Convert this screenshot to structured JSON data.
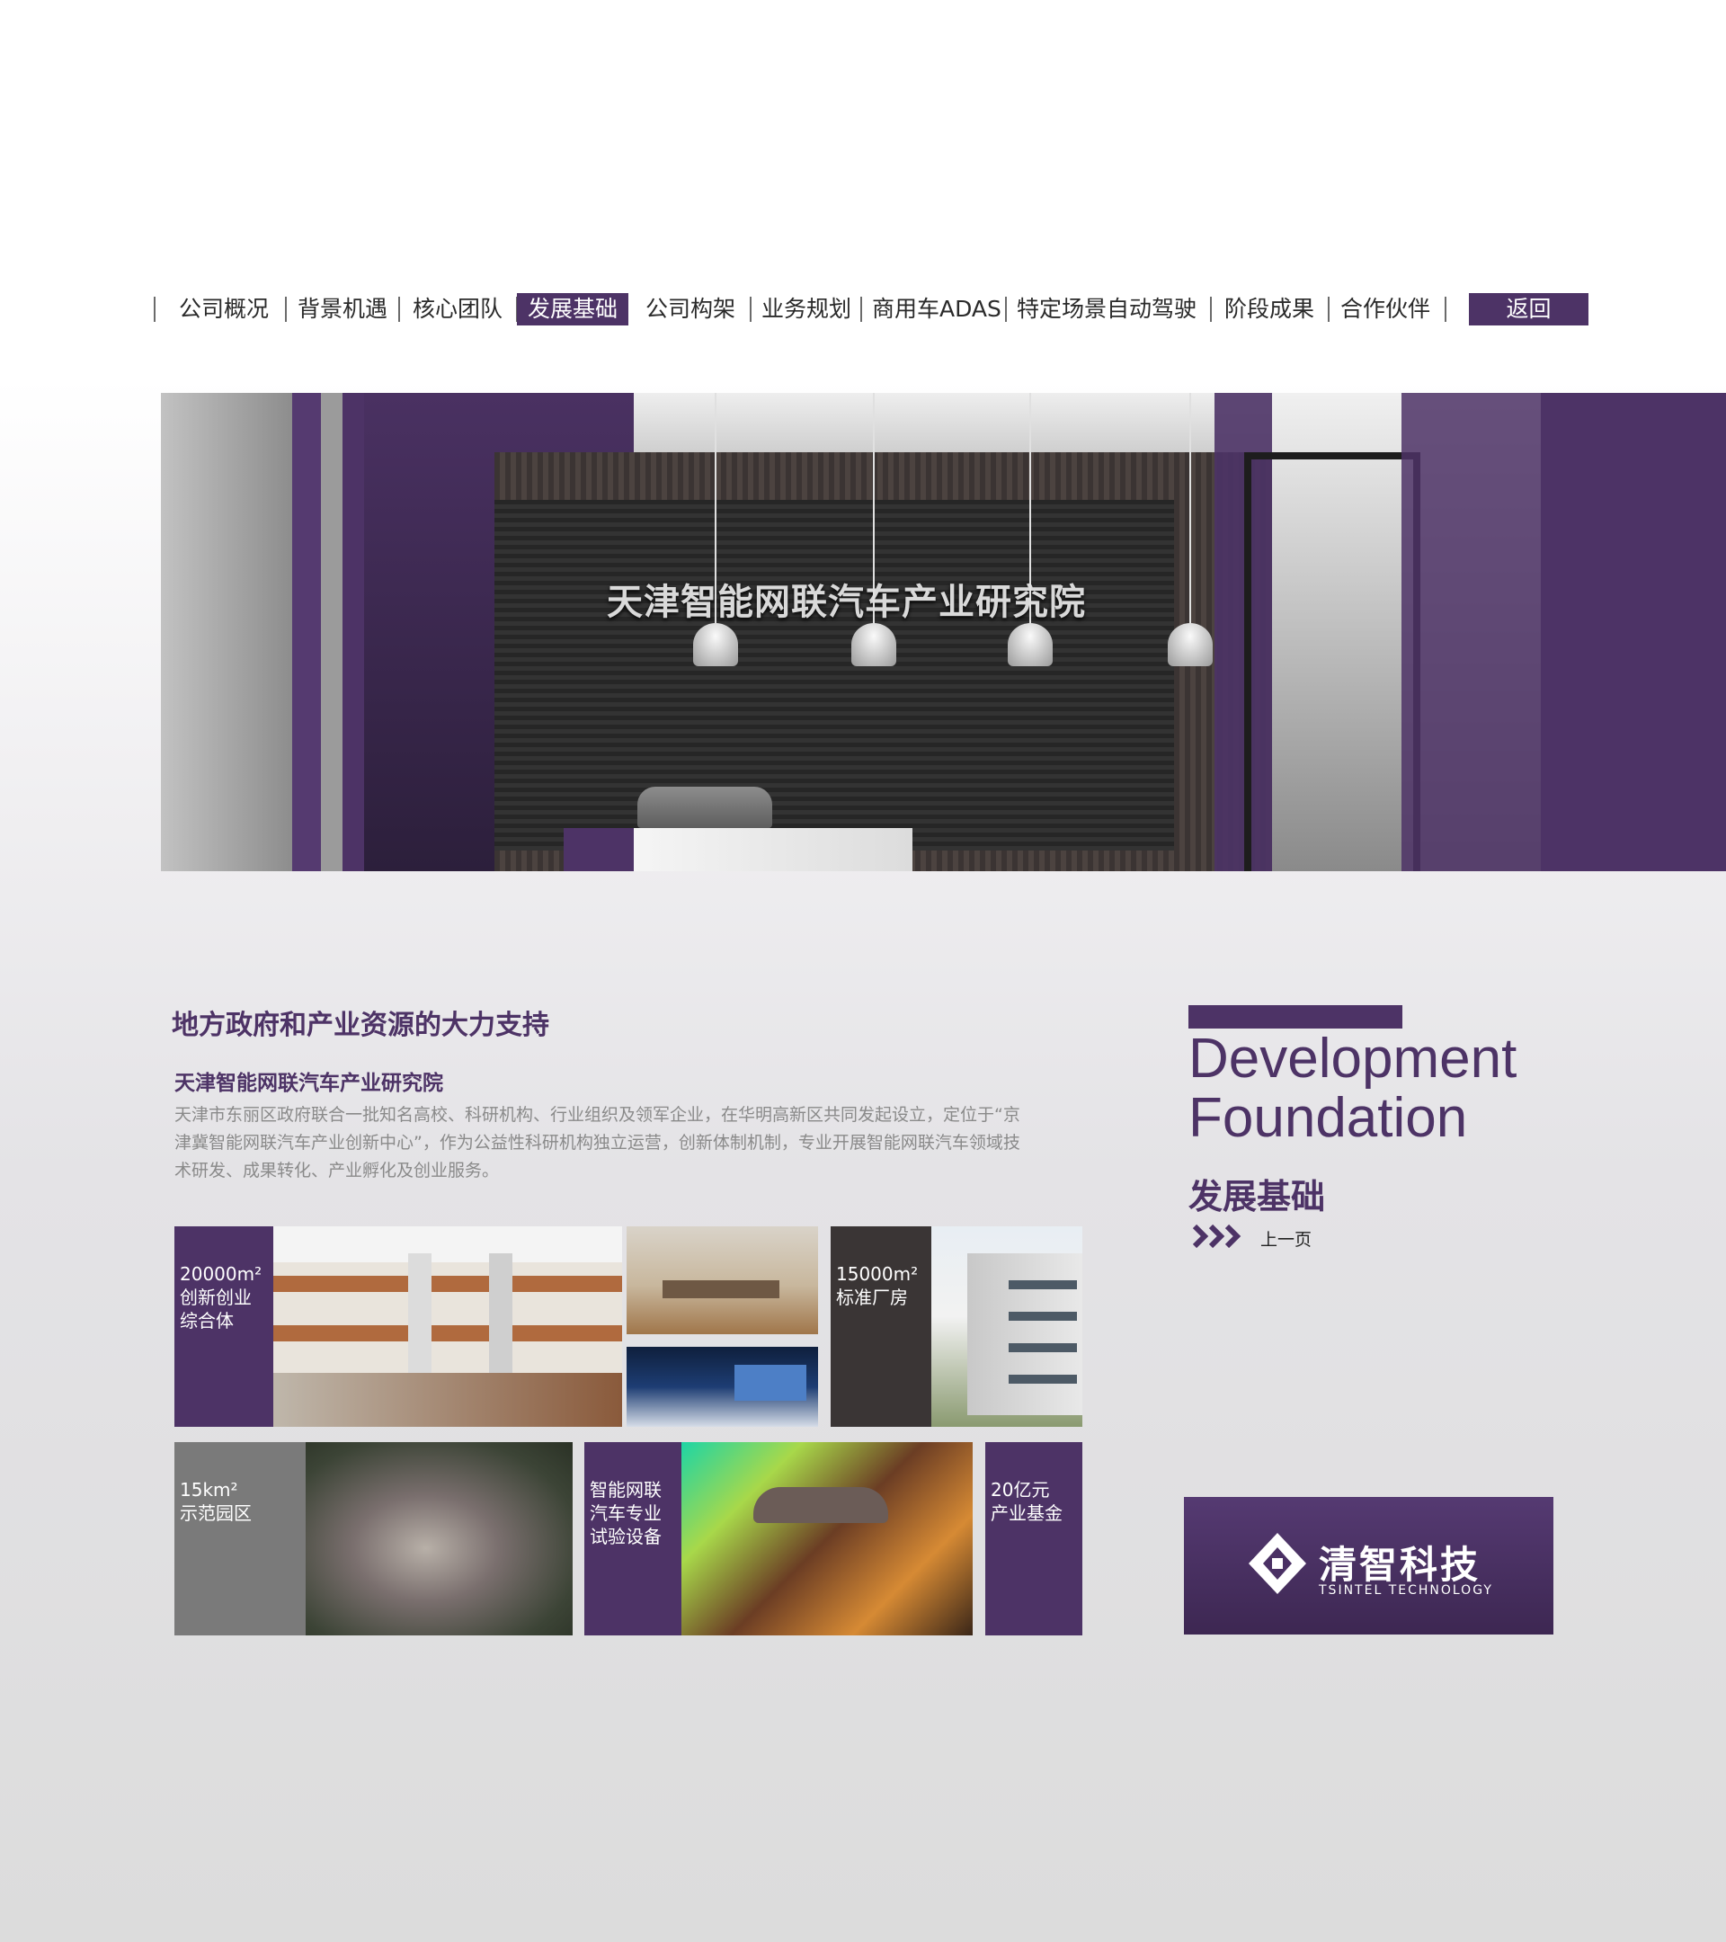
{
  "nav": {
    "items": [
      {
        "label": "公司概况",
        "active": false
      },
      {
        "label": "背景机遇",
        "active": false
      },
      {
        "label": "核心团队",
        "active": false
      },
      {
        "label": "发展基础",
        "active": true
      },
      {
        "label": "公司构架",
        "active": false
      },
      {
        "label": "业务规划",
        "active": false
      },
      {
        "label": "商用车ADAS",
        "active": false
      },
      {
        "label": "特定场景自动驾驶",
        "active": false
      },
      {
        "label": "阶段成果",
        "active": false
      },
      {
        "label": "合作伙伴",
        "active": false
      }
    ],
    "back_label": "返回"
  },
  "hero": {
    "sign_text": "天津智能网联汽车产业研究院"
  },
  "content": {
    "heading": "地方政府和产业资源的大力支持",
    "subheading": "天津智能网联汽车产业研究院",
    "body": "天津市东丽区政府联合一批知名高校、科研机构、行业组织及领军企业，在华明高新区共同发起设立，定位于“京津冀智能网联汽车产业创新中心”，作为公益性科研机构独立运营，创新体制机制，专业开展智能网联汽车领域技术研发、成果转化、产业孵化及创业服务。"
  },
  "tiles": {
    "campus": "20000m²\n创新创业\n综合体",
    "factory": "15000m²\n标准厂房",
    "demo_zone": "15km²\n示范园区",
    "equipment": "智能网联\n汽车专业\n试验设备",
    "fund": "20亿元\n产业基金"
  },
  "sidebar": {
    "title_en_line1": "Development",
    "title_en_line2": "Foundation",
    "title_cn": "发展基础",
    "prev_label": "上一页"
  },
  "logo": {
    "name_cn": "清智科技",
    "name_en": "TSINTEL TECHNOLOGY"
  },
  "colors": {
    "brand_purple": "#4d3366",
    "dark_tile": "#3a3535",
    "gray_tile": "#7a7a7a"
  }
}
